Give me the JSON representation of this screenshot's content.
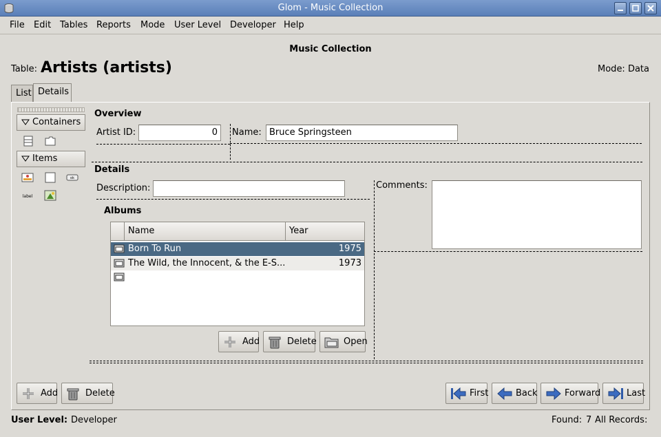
{
  "window": {
    "title": "Glom - Music Collection"
  },
  "menu": [
    "File",
    "Edit",
    "Tables",
    "Reports",
    "Mode",
    "User Level",
    "Developer",
    "Help"
  ],
  "header": {
    "database_title": "Music Collection",
    "table_label": "Table:",
    "table_name": "Artists (artists)",
    "mode_label": "Mode: Data"
  },
  "tabs": [
    "List",
    "Details"
  ],
  "palette": {
    "containers_label": "Containers",
    "items_label": "Items",
    "label_icon_text": "label",
    "ok_icon_text": "ok"
  },
  "overview": {
    "title": "Overview",
    "artist_id_label": "Artist ID:",
    "artist_id_value": "0",
    "name_label": "Name:",
    "name_value": "Bruce Springsteen"
  },
  "details": {
    "title": "Details",
    "description_label": "Description:",
    "description_value": "",
    "comments_label": "Comments:",
    "comments_value": ""
  },
  "albums": {
    "title": "Albums",
    "columns": [
      "Name",
      "Year"
    ],
    "rows": [
      {
        "name": "Born To Run",
        "year": "1975"
      },
      {
        "name": "The Wild, the Innocent, & the E-S...",
        "year": "1973"
      }
    ],
    "buttons": {
      "add": "Add",
      "delete": "Delete",
      "open": "Open"
    }
  },
  "record_buttons": {
    "add": "Add",
    "delete": "Delete"
  },
  "nav_buttons": {
    "first": "First",
    "back": "Back",
    "forward": "Forward",
    "last": "Last"
  },
  "status": {
    "user_level_label": "User Level:",
    "user_level_value": "Developer",
    "found_label": "Found:",
    "found_count": "7",
    "all_records": "All Records:"
  },
  "colors": {
    "titlebar": "#6a8bc2",
    "selection": "#4a6984",
    "background": "#dcdad5"
  }
}
